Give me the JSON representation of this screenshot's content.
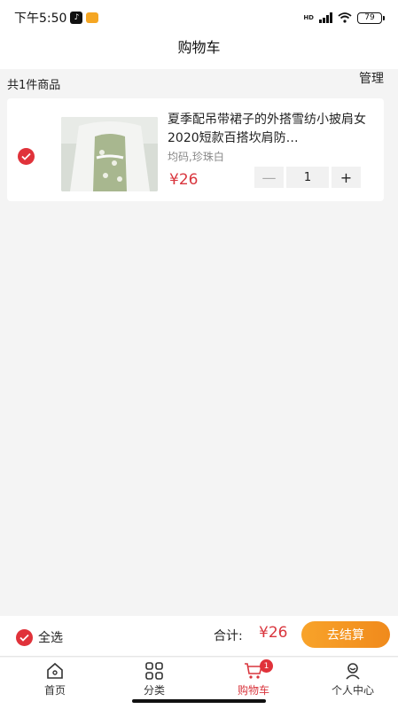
{
  "status_bar": {
    "time": "下午5:50",
    "network": "HD",
    "battery": "79"
  },
  "header": {
    "title": "购物车"
  },
  "summary": {
    "count_text": "共1件商品",
    "manage_label": "管理"
  },
  "cart_items": [
    {
      "title": "夏季配吊带裙子的外搭雪纺小披肩女2020短款百搭坎肩防…",
      "spec": "均码,珍珠白",
      "price": "¥26",
      "quantity": "1",
      "checked": true
    }
  ],
  "checkout": {
    "select_all_label": "全选",
    "total_label": "合计:",
    "total_value": "¥26",
    "checkout_label": "去结算"
  },
  "tabs": [
    {
      "label": "首页",
      "icon": "home-icon",
      "active": false
    },
    {
      "label": "分类",
      "icon": "grid-icon",
      "active": false
    },
    {
      "label": "购物车",
      "icon": "cart-icon",
      "active": true,
      "badge": "1"
    },
    {
      "label": "个人中心",
      "icon": "user-icon",
      "active": false
    }
  ],
  "colors": {
    "accent": "#d9363e",
    "checkout_button": "#f49a24"
  }
}
